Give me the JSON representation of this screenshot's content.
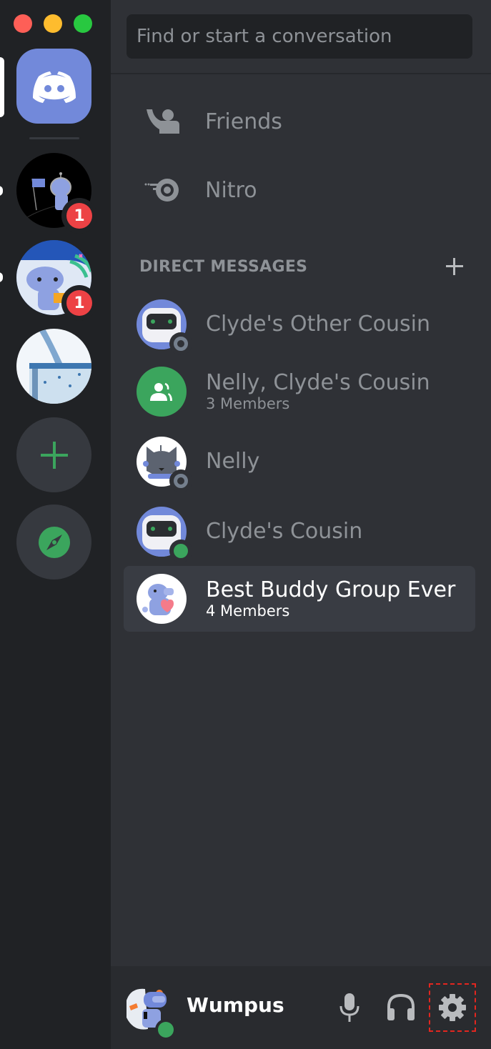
{
  "window": {
    "traffic_lights": [
      "close",
      "minimize",
      "zoom"
    ]
  },
  "rail": {
    "home": {
      "name": "Direct Messages",
      "icon": "discord-logo-icon",
      "color": "#7289da",
      "active": true
    },
    "servers": [
      {
        "name": "astronaut-server",
        "badge": "1",
        "unread": true
      },
      {
        "name": "wumpus-server",
        "badge": "1",
        "unread": true
      },
      {
        "name": "water-server",
        "badge": null,
        "unread": false
      }
    ],
    "add_server_icon": "plus-icon",
    "explore_icon": "compass-icon",
    "accent_green": "#3ba55d"
  },
  "search": {
    "placeholder": "Find or start a conversation"
  },
  "nav": {
    "friends_label": "Friends",
    "nitro_label": "Nitro"
  },
  "direct_messages": {
    "header": "DIRECT MESSAGES",
    "add_icon": "plus-icon",
    "items": [
      {
        "name": "Clyde's Other Cousin",
        "sub": "",
        "status": "offline",
        "avatar": "robot-avatar"
      },
      {
        "name": "Nelly, Clyde's Cousin",
        "sub": "3 Members",
        "status": null,
        "avatar": "group-avatar"
      },
      {
        "name": "Nelly",
        "sub": "",
        "status": "offline",
        "avatar": "cat-avatar"
      },
      {
        "name": "Clyde's Cousin",
        "sub": "",
        "status": "online",
        "avatar": "robot-avatar"
      },
      {
        "name": "Best Buddy Group Ever",
        "sub": "4 Members",
        "status": null,
        "avatar": "wumpus-heart-avatar",
        "selected": true
      }
    ]
  },
  "user": {
    "name": "Wumpus",
    "status": "online",
    "controls": [
      "microphone",
      "headset",
      "settings"
    ]
  },
  "colors": {
    "highlight_box": "#e3261f",
    "online": "#3ba55d",
    "offline": "#747f8d",
    "badge": "#ed4245"
  }
}
